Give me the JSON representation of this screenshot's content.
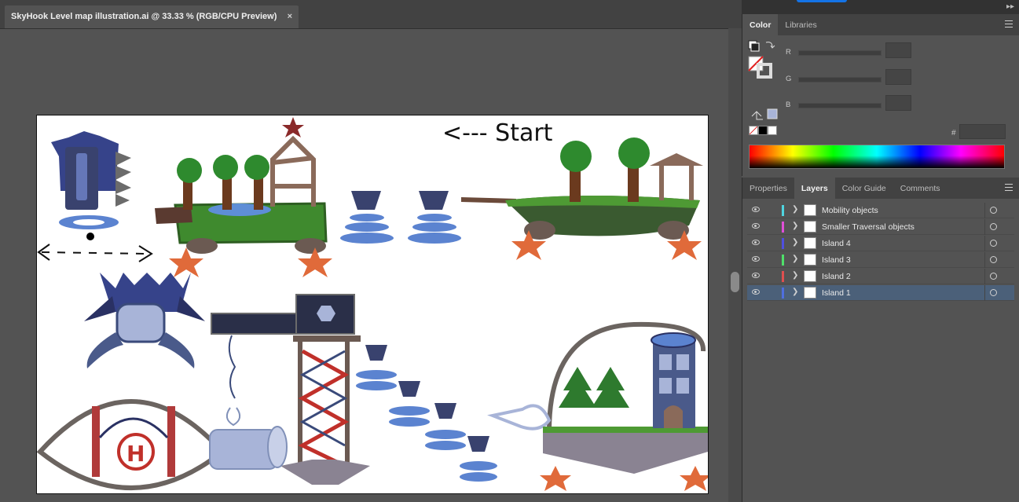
{
  "document": {
    "tab_title": "SkyHook Level map illustration.ai @ 33.33 % (RGB/CPU Preview)",
    "close_glyph": "×",
    "artboard_start_text": "<--- Start"
  },
  "color_panel": {
    "tabs": [
      "Color",
      "Libraries"
    ],
    "active_tab": "Color",
    "rgb_labels": [
      "R",
      "G",
      "B"
    ],
    "hex_label": "#",
    "swatches": [
      "none",
      "#000000",
      "#ffffff"
    ]
  },
  "layers_panel": {
    "tabs": [
      "Properties",
      "Layers",
      "Color Guide",
      "Comments"
    ],
    "active_tab": "Layers",
    "layers": [
      {
        "name": "Mobility objects",
        "color": "#4fd5e0",
        "selected": false
      },
      {
        "name": "Smaller Traversal objects",
        "color": "#e04fd8",
        "selected": false
      },
      {
        "name": "Island 4",
        "color": "#4f4fe0",
        "selected": false
      },
      {
        "name": "Island 3",
        "color": "#4fe06a",
        "selected": false
      },
      {
        "name": "Island 2",
        "color": "#e04f4f",
        "selected": false
      },
      {
        "name": "Island 1",
        "color": "#4f6fe0",
        "selected": true
      }
    ]
  },
  "icons": {
    "visibility": "eye-icon",
    "expand": "chevron-right-icon",
    "target": "target-circle-icon",
    "panel_menu": "hamburger-menu-icon"
  }
}
